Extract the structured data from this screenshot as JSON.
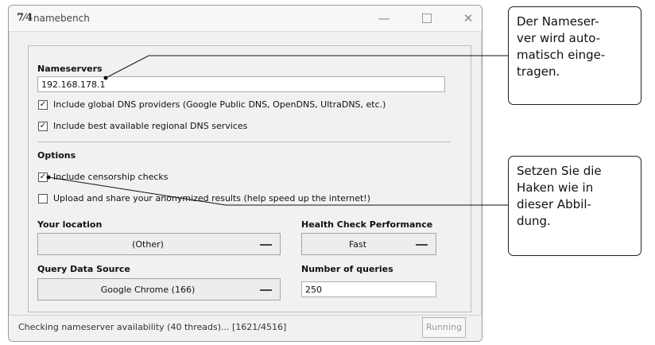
{
  "window": {
    "title": "namebench",
    "app_icon": "7⁄4",
    "controls": {
      "minimize": "—",
      "close": "✕"
    }
  },
  "nameservers": {
    "label": "Nameservers",
    "value": "192.168.178.1",
    "global_providers": {
      "label": "Include global DNS providers (Google Public DNS, OpenDNS, UltraDNS, etc.)",
      "checked": true
    },
    "regional": {
      "label": "Include best available regional DNS services",
      "checked": true
    }
  },
  "options": {
    "label": "Options",
    "censorship": {
      "label": "Include censorship checks",
      "checked": true
    },
    "share": {
      "label": "Upload and share your anonymized results (help speed up the internet!)",
      "checked": false
    }
  },
  "location": {
    "label": "Your location",
    "value": "(Other)"
  },
  "health": {
    "label": "Health Check Performance",
    "value": "Fast"
  },
  "query_source": {
    "label": "Query Data Source",
    "value": "Google Chrome (166)"
  },
  "queries": {
    "label": "Number of queries",
    "value": "250"
  },
  "status": {
    "text": "Checking nameserver availability (40 threads)... [1621/4516]",
    "button": "Running"
  },
  "callouts": {
    "first": "Der Nameser-\nver wird auto-\nmatisch einge-\ntragen.",
    "second": "Setzen Sie die\nHaken wie in\ndieser Abbil-\ndung."
  },
  "icons": {
    "checkmark": "✓",
    "window_icon": "namebench-app-icon",
    "minimize_icon": "minimize-icon",
    "maximize_icon": "maximize-icon",
    "close_icon": "close-icon"
  }
}
